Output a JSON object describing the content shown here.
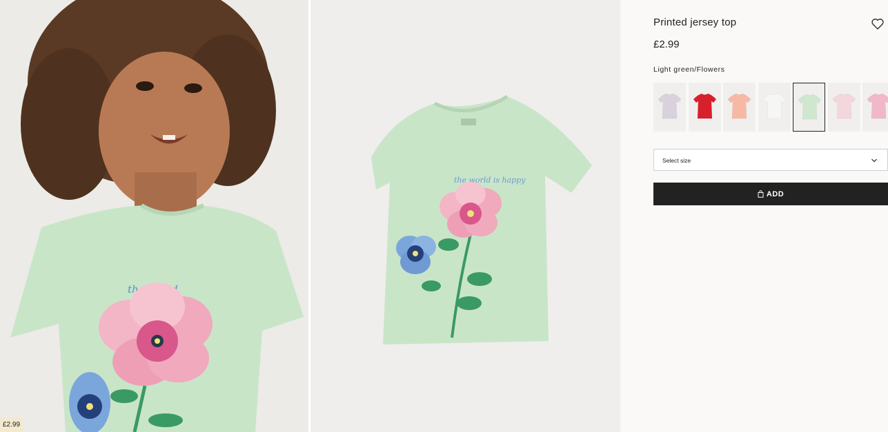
{
  "product": {
    "title": "Printed jersey top",
    "price": "£2.99",
    "color_name": "Light green/Flowers",
    "image_price_tag": "£2.99"
  },
  "size_selector": {
    "placeholder": "Select size"
  },
  "add_button": {
    "label": "ADD"
  },
  "swatches": [
    {
      "name": "lilac-print",
      "color": "#d9d2dc"
    },
    {
      "name": "red",
      "color": "#d81f2c"
    },
    {
      "name": "peach",
      "color": "#f7b9a6"
    },
    {
      "name": "white-love",
      "color": "#f6f6f4"
    },
    {
      "name": "light-green-flowers",
      "color": "#cfe7cf",
      "selected": true
    },
    {
      "name": "light-pink",
      "color": "#f3d7dc"
    },
    {
      "name": "pink",
      "color": "#f0b8c8"
    }
  ],
  "colors": {
    "button_bg": "#222222",
    "tag_bg": "#f3e9d0",
    "tshirt_green": "#c9e5c8"
  },
  "icons": {
    "wishlist": "heart-icon",
    "dropdown": "chevron-down-icon",
    "bag": "bag-icon"
  }
}
